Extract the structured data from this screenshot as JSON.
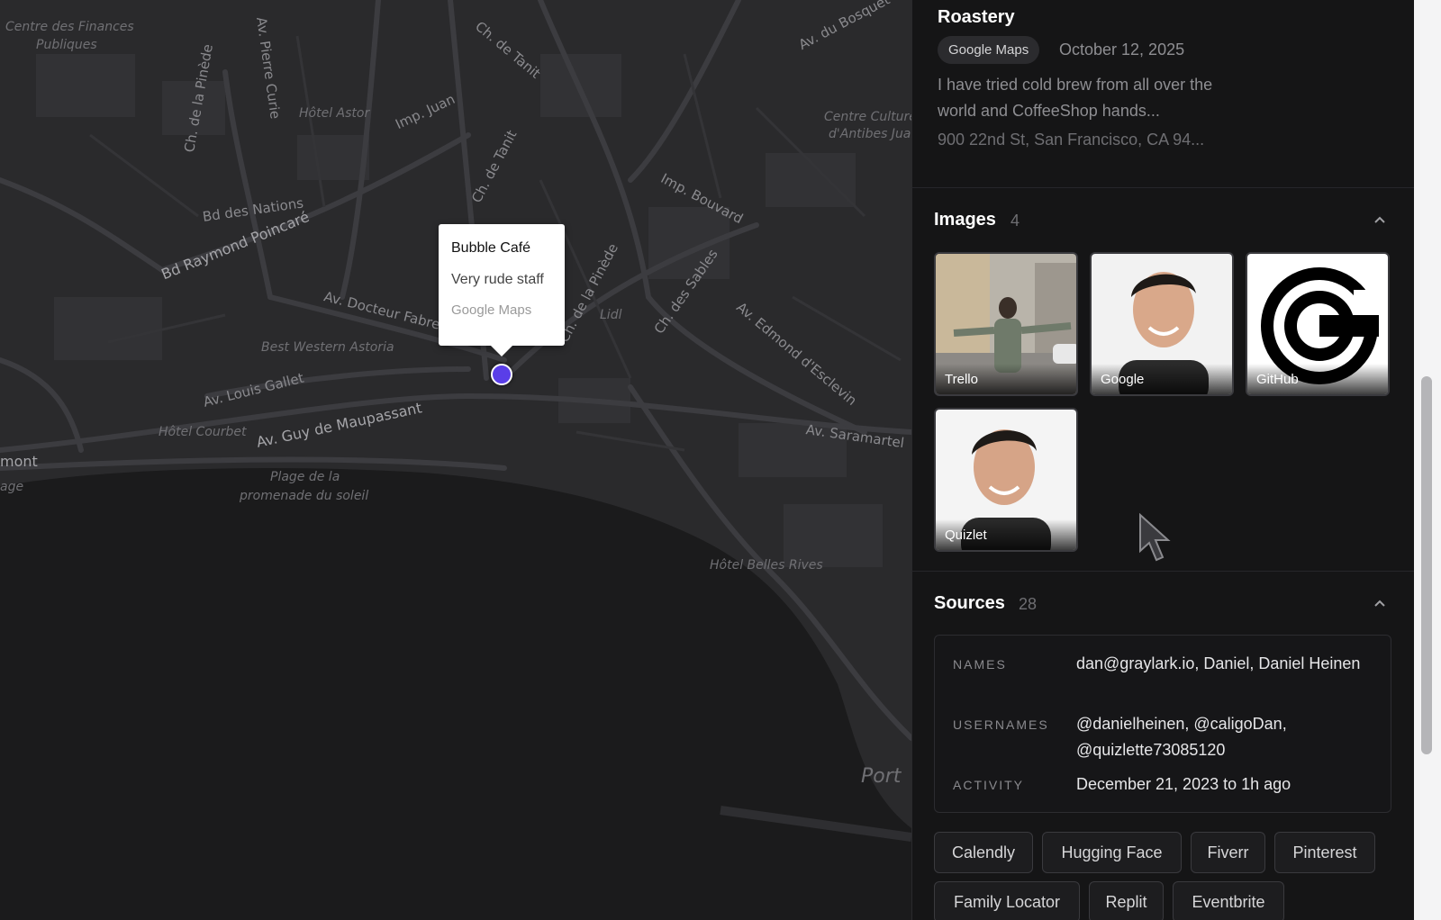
{
  "map": {
    "labels": [
      "Centre des Finances",
      "Publiques",
      "Av. Pierre Curie",
      "Ch. de la Pinède",
      "Hôtel Astor",
      "Imp. Juan",
      "Ch. de Tanit",
      "Ch. de Tanit",
      "Av. du Bosquet",
      "Centre Culturel",
      "d'Antibes Juan",
      "Imp. Bouvard",
      "Bd des Nations",
      "Bd Raymond Poincaré",
      "Av. Docteur Fabre",
      "Ch. de la Pinède",
      "Lidl",
      "Ch. des Sables",
      "Av. Edmond d'Esclevin",
      "Best Western Astoria",
      "Av. Louis Gallet",
      "Hôtel Courbet",
      "Av. Guy de Maupassant",
      "Av. Saramartel",
      "mont",
      "age",
      "Plage de la",
      "promenade du soleil",
      "Hôtel Belles Rives",
      "Port"
    ],
    "popup": {
      "title": "Bubble Café",
      "text": "Very rude staff",
      "source": "Google Maps"
    },
    "pin_color": "#5a3ee8"
  },
  "panel": {
    "place": {
      "title": "Roastery",
      "source_chip": "Google Maps",
      "date": "October 12, 2025",
      "description": "I have tried cold brew from all over the world and CoffeeShop hands...",
      "address": "900 22nd St, San Francisco, CA 94..."
    },
    "images": {
      "title": "Images",
      "count": "4",
      "items": [
        {
          "label": "Trello"
        },
        {
          "label": "Google"
        },
        {
          "label": "GitHub"
        },
        {
          "label": "Quizlet"
        }
      ]
    },
    "sources": {
      "title": "Sources",
      "count": "28",
      "names_key": "NAMES",
      "names_value": "dan@graylark.io, Daniel, Daniel Heinen",
      "usernames_key": "USERNAMES",
      "usernames_value": "@danielheinen, @caligoDan, @quizlette73085120",
      "activity_key": "ACTIVITY",
      "activity_value": "December 21, 2023 to 1h ago",
      "tags": [
        "Calendly",
        "Hugging Face",
        "Fiverr",
        "Pinterest",
        "Family Locator",
        "Replit",
        "Eventbrite"
      ]
    }
  }
}
